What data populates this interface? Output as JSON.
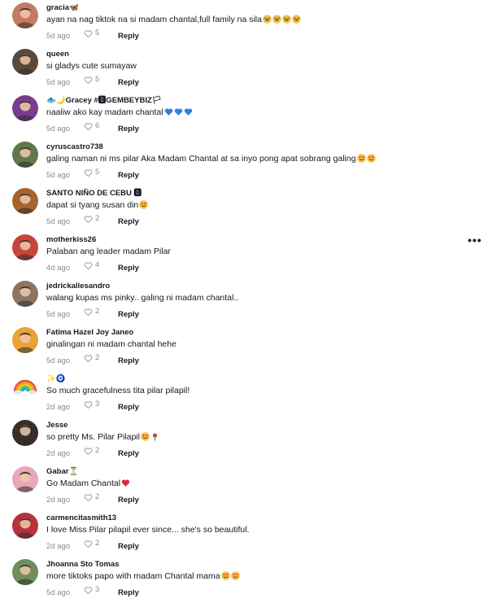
{
  "comments": [
    {
      "user": "gracia🦋",
      "text": "ayan na nag tiktok na si madam chantal,full family na sila",
      "emojis": [
        "laugh",
        "laugh",
        "laugh",
        "laugh"
      ],
      "time": "5d ago",
      "likes": "5",
      "reply": "Reply",
      "avatar": "#c47a63"
    },
    {
      "user": "queen",
      "text": "si gladys cute sumayaw",
      "emojis": [],
      "time": "5d ago",
      "likes": "5",
      "reply": "Reply",
      "avatar": "#5b4a3c"
    },
    {
      "user": "🐟🌙Gracey #🅱GEMBEYBIZ🏳",
      "text": "naaliw ako kay madam chantal",
      "emojis": [
        "blueheart",
        "blueheart",
        "blueheart"
      ],
      "time": "5d ago",
      "likes": "6",
      "reply": "Reply",
      "avatar": "#7a3c8e"
    },
    {
      "user": "cyruscastro738",
      "text": "galing naman ni ms pilar Aka Madam Chantal at sa inyo pong apat sobrang galing",
      "emojis": [
        "hearteyes",
        "hearteyes"
      ],
      "time": "5d ago",
      "likes": "5",
      "reply": "Reply",
      "avatar": "#5e7a4b"
    },
    {
      "user": "SANTO NIÑO DE CEBU 🅱",
      "text": "dapat si tyang susan din",
      "emojis": [
        "hearteyes"
      ],
      "time": "5d ago",
      "likes": "2",
      "reply": "Reply",
      "avatar": "#a5642f"
    },
    {
      "user": "motherkiss26",
      "text": "Palaban ang leader madam Pilar",
      "emojis": [],
      "time": "4d ago",
      "likes": "4",
      "reply": "Reply",
      "avatar": "#c8453a"
    },
    {
      "user": "jedrickallesandro",
      "text": "walang kupas ms pinky.. galing ni madam chantal..",
      "emojis": [],
      "time": "5d ago",
      "likes": "2",
      "reply": "Reply",
      "avatar": "#8b7565"
    },
    {
      "user": "Fatima Hazel Joy Janeo",
      "text": "ginalingan ni madam chantal hehe",
      "emojis": [],
      "time": "5d ago",
      "likes": "2",
      "reply": "Reply",
      "avatar": "#e8a23a"
    },
    {
      "user": "✨🧿",
      "text": "So much gracefulness tita pilar pilapil!",
      "emojis": [],
      "time": "2d ago",
      "likes": "3",
      "reply": "Reply",
      "avatar": "#ffffff"
    },
    {
      "user": "Jesse",
      "text": "so pretty Ms. Pilar Pilapil",
      "emojis": [
        "hearteyes",
        "rose"
      ],
      "time": "2d ago",
      "likes": "2",
      "reply": "Reply",
      "avatar": "#3a2e2a"
    },
    {
      "user": "Gabar⏳",
      "text": "Go Madam Chantal",
      "emojis": [
        "redheart"
      ],
      "time": "2d ago",
      "likes": "2",
      "reply": "Reply",
      "avatar": "#e6a9b8"
    },
    {
      "user": "carmencitasmith13",
      "text": "I love Miss Pilar pilapil ever since... she's so beautiful.",
      "emojis": [],
      "time": "2d ago",
      "likes": "2",
      "reply": "Reply",
      "avatar": "#b8313f"
    },
    {
      "user": "Jhoanna Sto Tomas",
      "text": "more tiktoks papo with madam Chantal mama",
      "emojis": [
        "hearteyes",
        "hearteyes"
      ],
      "time": "5d ago",
      "likes": "3",
      "reply": "Reply",
      "avatar": "#6f8e5c"
    }
  ],
  "more_icon": "ellipsis-icon",
  "more_label": "•••"
}
